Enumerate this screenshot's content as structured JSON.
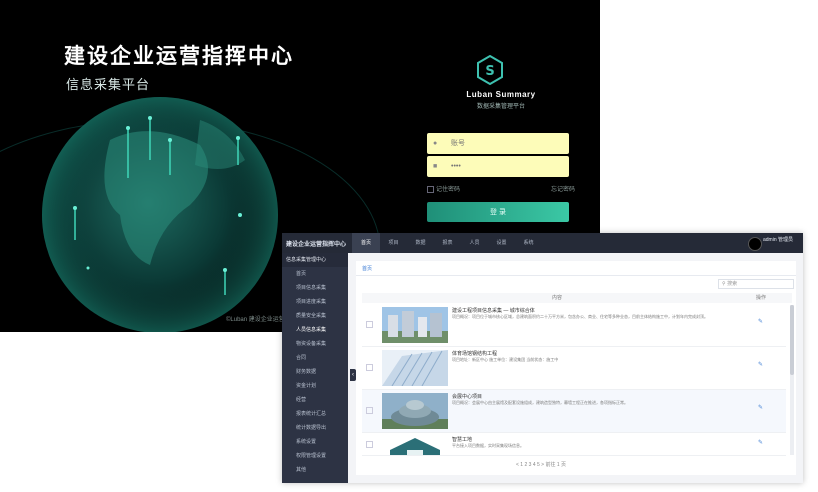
{
  "login": {
    "title": "建设企业运营指挥中心",
    "subtitle": "信息采集平台",
    "brand_name": "Luban Summary",
    "brand_sub": "数据采集管理平台",
    "username_placeholder": "账号",
    "password_placeholder": "••••",
    "remember_label": "记住密码",
    "forgot_label": "忘记密码",
    "login_button": "登 录",
    "footer": "©Luban   建设企业运营指挥中心 版权所有"
  },
  "admin": {
    "system_title": "建设企业运营指挥中心",
    "top_tabs": [
      "首页",
      "项目",
      "数据",
      "报表",
      "人员",
      "设置",
      "系统"
    ],
    "active_tab_index": 0,
    "user_name": "admin 管理员",
    "sidebar_group": "信息采集管理中心",
    "sidebar_items": [
      "首页",
      "项目信息采集",
      "项目进度采集",
      "质量安全采集",
      "人员信息采集",
      "物资设备采集",
      "合同",
      "财务数据",
      "资金计划",
      "经营",
      "报表统计汇总",
      "统计数据导出",
      "系统设置",
      "权限管理设置",
      "其他"
    ],
    "active_sidebar_index": 4,
    "breadcrumb": "首页",
    "search_placeholder": "搜索",
    "table_headers": [
      "",
      "",
      "内容",
      "操作"
    ],
    "rows": [
      {
        "title": "建设工程项目信息采集 — 城市综合体",
        "desc": "项目概况：项目位于城市核心区域，总建筑面积约二十万平方米，包含办公、商业、住宅等多种业态，目前主体结构施工中，计划年内完成封顶。"
      },
      {
        "title": "体育场馆钢结构工程",
        "desc": "项目地址：新区中心  施工单位：建设集团  当前状态：施工中"
      },
      {
        "title": "会展中心项目",
        "desc": "项目概况：会展中心由主展馆及配套设施组成，建筑造型独特，幕墙工程正在推进，各项指标正常。"
      },
      {
        "title": "智慧工地",
        "desc": "平台接入项目数据，实时采集现场信息。"
      }
    ],
    "pager": "< 1 2 3 4 5 >   前往  1  页"
  },
  "colors": {
    "accent": "#2bb596",
    "topbar": "#252a37",
    "sidebar": "#2d3344",
    "input_fill": "#fdfcb9"
  }
}
